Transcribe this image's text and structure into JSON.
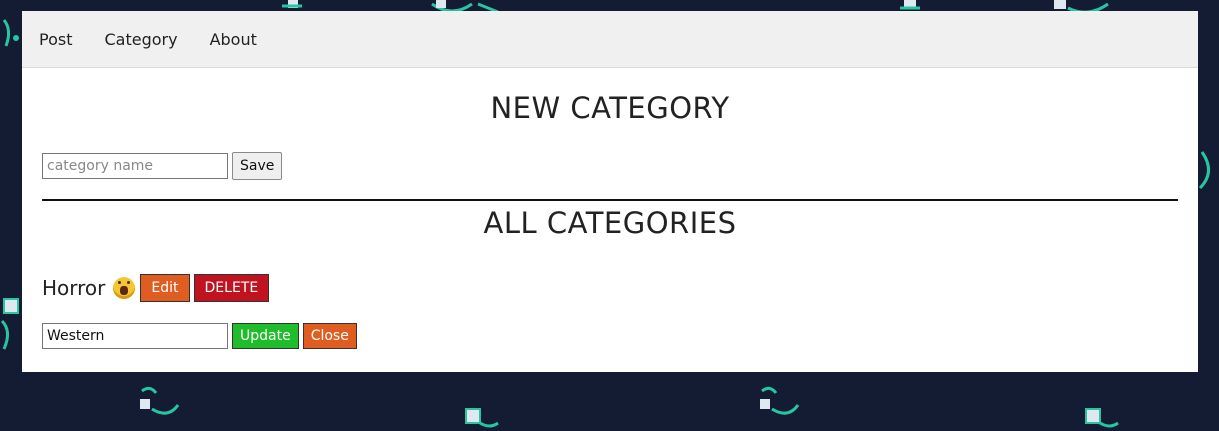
{
  "nav": {
    "items": [
      {
        "label": "Post"
      },
      {
        "label": "Category"
      },
      {
        "label": "About"
      }
    ]
  },
  "new_category": {
    "title": "NEW CATEGORY",
    "input_placeholder": "category name",
    "input_value": "",
    "save_label": "Save"
  },
  "all_categories": {
    "title": "ALL CATEGORIES",
    "items": [
      {
        "name": "Horror",
        "icon": "screaming-face-emoji-icon",
        "edit_label": "Edit",
        "delete_label": "DELETE"
      }
    ],
    "editing": {
      "input_value": "Western",
      "update_label": "Update",
      "close_label": "Close"
    }
  },
  "colors": {
    "page_background": "#131c33",
    "edit_button": "#e05d22",
    "delete_button": "#c1121f",
    "update_button": "#1fbd2b",
    "close_button": "#e05d22",
    "navbar": "#f0f0f0"
  }
}
